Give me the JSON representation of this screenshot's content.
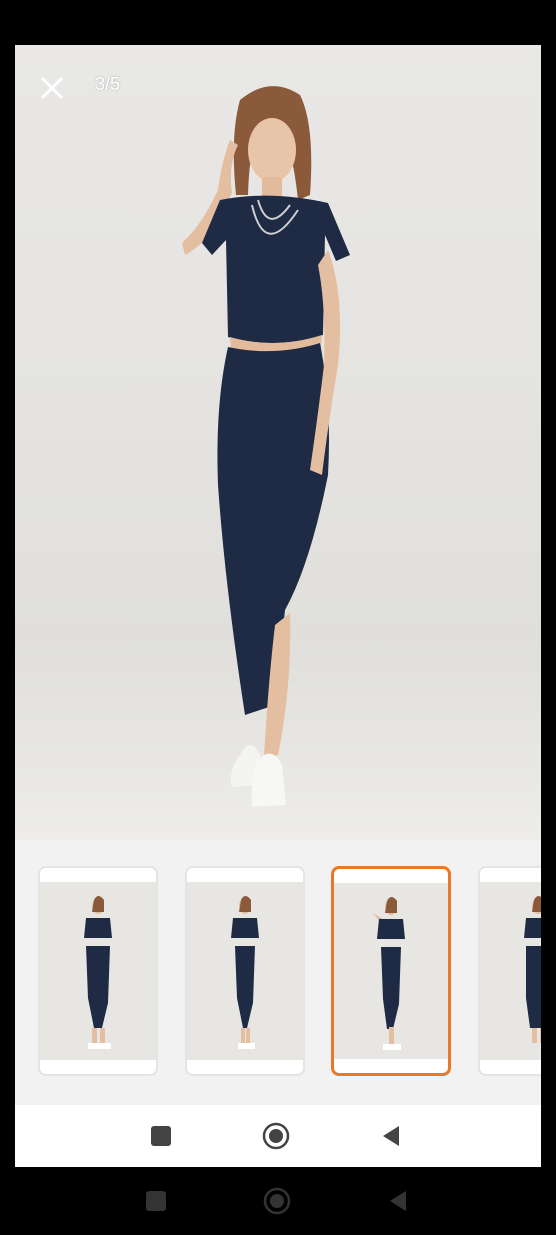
{
  "viewer": {
    "counter": "3/5",
    "current_index": 3,
    "total": 5
  },
  "thumbnails": [
    {
      "name": "thumb-1",
      "selected": false
    },
    {
      "name": "thumb-2",
      "selected": false
    },
    {
      "name": "thumb-3",
      "selected": true
    },
    {
      "name": "thumb-4",
      "selected": false
    }
  ],
  "colors": {
    "accent_selected": "#e77a2a",
    "outfit": "#1f2a44",
    "background": "#e5e4e1"
  },
  "icons": {
    "close": "close-icon",
    "nav_square": "square-icon",
    "nav_home": "circle-icon",
    "nav_back": "triangle-back-icon"
  }
}
